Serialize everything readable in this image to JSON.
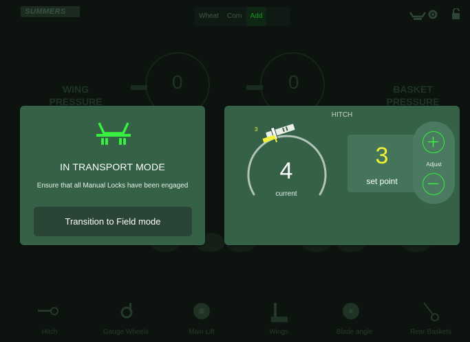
{
  "brand": {
    "name": "SUMMERS"
  },
  "crop_tabs": [
    "Wheat",
    "Corn",
    "Add"
  ],
  "top_icons": [
    "hitch-transport-icon",
    "gear-icon",
    "lock-icon"
  ],
  "background": {
    "wing_pressure_label": "WING\nPRESSURE",
    "basket_pressure_label": "BASKET\nPRESSURE",
    "gauge_left_value": "0",
    "gauge_right_value": "0"
  },
  "bottom_nav": [
    "Hitch",
    "Gauge Wheels",
    "Main Lift",
    "Wings",
    "Blade angle",
    "Rear Baskets"
  ],
  "transport_panel": {
    "title": "IN TRANSPORT MODE",
    "message": "Ensure that all Manual Locks have been engaged",
    "button_label": "Transition to Field mode"
  },
  "hitch_panel": {
    "title": "HITCH",
    "current_value": "4",
    "current_label": "current",
    "setpoint_value": "3",
    "setpoint_label": "set point",
    "adjust_label": "Adjust",
    "marker_value": "3"
  },
  "colors": {
    "accent_green": "#37f040",
    "setpoint_yellow": "#f1f13b",
    "panel_bg": "#356246"
  }
}
